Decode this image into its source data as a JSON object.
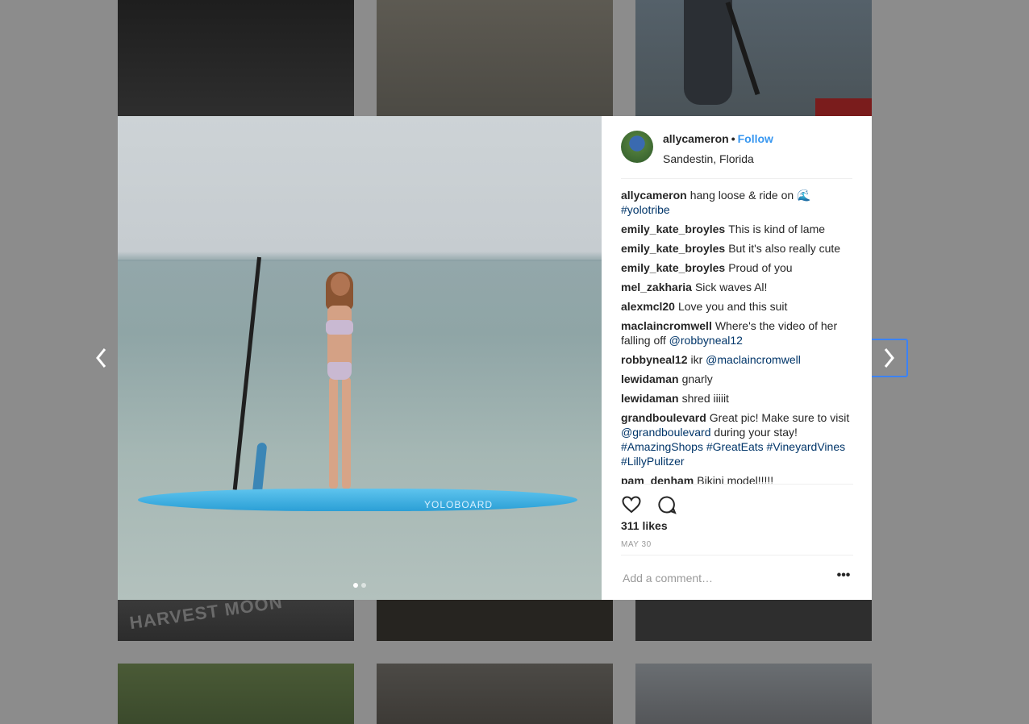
{
  "post": {
    "username": "allycameron",
    "separator": "•",
    "follow_label": "Follow",
    "location": "Sandestin, Florida",
    "likes": "311 likes",
    "date": "MAY 30",
    "board_logo": "YOLOBOARD"
  },
  "comments": [
    {
      "user": "allycameron",
      "text": "hang loose & ride on 🌊 ",
      "tag": "#yolotribe"
    },
    {
      "user": "emily_kate_broyles",
      "text": "This is kind of lame"
    },
    {
      "user": "emily_kate_broyles",
      "text": "But it's also really cute"
    },
    {
      "user": "emily_kate_broyles",
      "text": "Proud of you"
    },
    {
      "user": "mel_zakharia",
      "text": "Sick waves Al!"
    },
    {
      "user": "alexmcl20",
      "text": "Love you and this suit"
    },
    {
      "user": "maclaincromwell",
      "text": "Where's the video of her falling off ",
      "tag": "@robbyneal12"
    },
    {
      "user": "robbyneal12",
      "text": "ikr ",
      "tag": "@maclaincromwell"
    },
    {
      "user": "lewidaman",
      "text": "gnarly"
    },
    {
      "user": "lewidaman",
      "text": "shred iiiiit"
    },
    {
      "user": "grandboulevard",
      "text": "Great pic! Make sure to visit ",
      "tag": "@grandboulevard",
      "text2": " during your stay! ",
      "tags2": "#AmazingShops #GreatEats #VineyardVines #LillyPulitzer"
    },
    {
      "user": "pam_denham",
      "text": "Bikini model!!!!!"
    }
  ],
  "comment_box": {
    "placeholder": "Add a comment…",
    "more_label": "•••"
  },
  "carousel": {
    "count": 2,
    "active": 0
  },
  "background_tiles": {
    "harvest_text": "HARVEST MOON"
  },
  "colors": {
    "link": "#3897f0",
    "hashtag": "#003569",
    "focus": "#3b82f6"
  }
}
